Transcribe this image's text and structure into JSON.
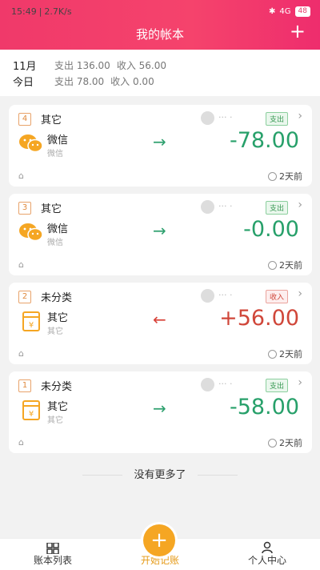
{
  "status_bar": {
    "time": "15:49",
    "speed": "2.7K/s",
    "battery": "48",
    "signal_text": "4G"
  },
  "header": {
    "title": "我的帐本"
  },
  "summary": {
    "month_label": "11月",
    "month_expense": "支出 136.00",
    "month_income": "收入 56.00",
    "today_label": "今日",
    "today_expense": "支出 78.00",
    "today_income": "收入 0.00"
  },
  "records": [
    {
      "num": "4",
      "category": "其它",
      "type_label": "支出",
      "account": "微信",
      "account_sub": "微信",
      "amount": "-78.00",
      "time": "2天前",
      "kind": "out"
    },
    {
      "num": "3",
      "category": "其它",
      "type_label": "支出",
      "account": "微信",
      "account_sub": "微信",
      "amount": "-0.00",
      "time": "2天前",
      "kind": "out"
    },
    {
      "num": "2",
      "category": "未分类",
      "type_label": "收入",
      "account": "其它",
      "account_sub": "其它",
      "amount": "+56.00",
      "time": "2天前",
      "kind": "in"
    },
    {
      "num": "1",
      "category": "未分类",
      "type_label": "支出",
      "account": "其它",
      "account_sub": "其它",
      "amount": "-58.00",
      "time": "2天前",
      "kind": "out"
    }
  ],
  "footer": {
    "no_more": "没有更多了"
  },
  "tabbar": {
    "list": "账本列表",
    "start": "开始记账",
    "me": "个人中心"
  },
  "colors": {
    "header": "#f0396a",
    "expense": "#27a06a",
    "income": "#d0473a",
    "start_btn": "#f5a623"
  }
}
